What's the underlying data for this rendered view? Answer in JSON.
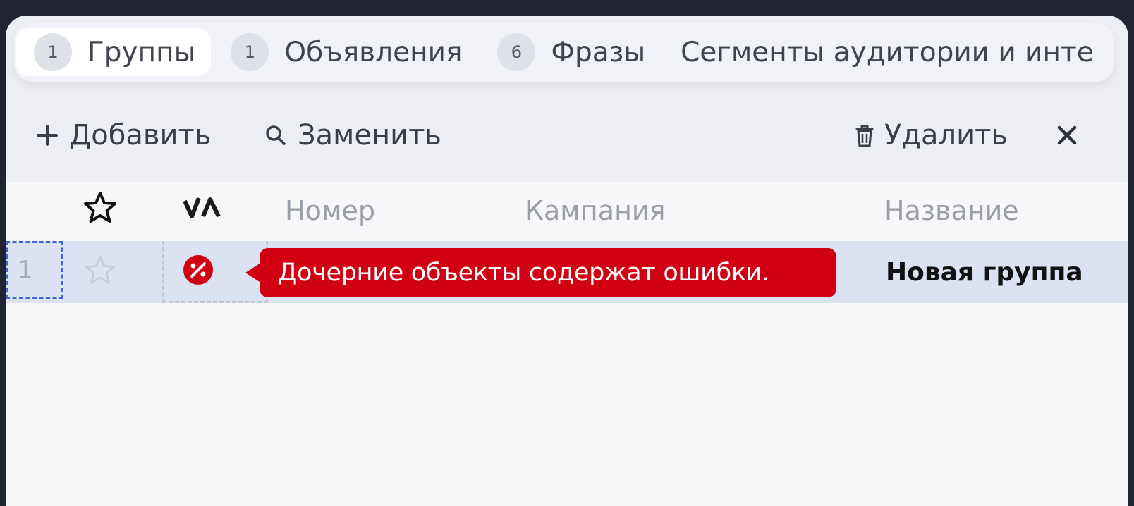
{
  "tabs": [
    {
      "count": "1",
      "label": "Группы",
      "active": true
    },
    {
      "count": "1",
      "label": "Объявления",
      "active": false
    },
    {
      "count": "6",
      "label": "Фразы",
      "active": false
    },
    {
      "count": "",
      "label": "Сегменты аудитории и инте",
      "active": false
    }
  ],
  "toolbar": {
    "add_label": "Добавить",
    "replace_label": "Заменить",
    "delete_label": "Удалить"
  },
  "table": {
    "columns": {
      "number": "Номер",
      "campaign": "Кампания",
      "name": "Название"
    },
    "rows": [
      {
        "index": "1",
        "status_message": "Дочерние объекты содержат ошибки.",
        "name": "Новая группа"
      }
    ]
  },
  "colors": {
    "error": "#d10012",
    "selected_row": "#dbe2f1",
    "focus_outline": "#3d67d6"
  },
  "icons": [
    "plus-icon",
    "search-icon",
    "trash-icon",
    "close-icon",
    "star-icon",
    "sort-icon",
    "error-status-icon"
  ]
}
